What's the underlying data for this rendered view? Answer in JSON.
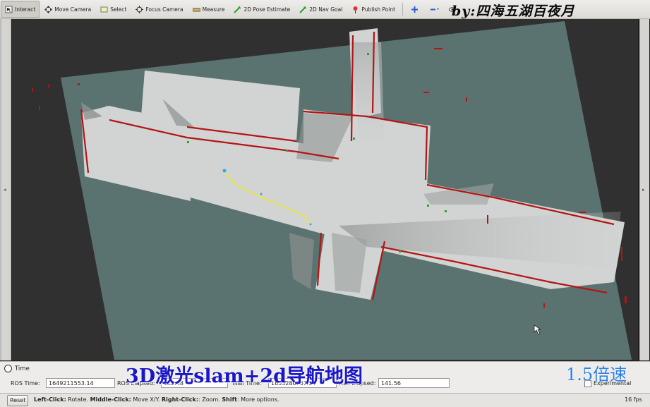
{
  "toolbar": {
    "tools": [
      {
        "label": "Interact",
        "icon": "interact-icon",
        "active": true
      },
      {
        "label": "Move Camera",
        "icon": "move-camera-icon"
      },
      {
        "label": "Select",
        "icon": "select-icon"
      },
      {
        "label": "Focus Camera",
        "icon": "focus-camera-icon"
      },
      {
        "label": "Measure",
        "icon": "measure-icon"
      },
      {
        "label": "2D Pose Estimate",
        "icon": "pose-estimate-icon"
      },
      {
        "label": "2D Nav Goal",
        "icon": "nav-goal-icon"
      },
      {
        "label": "Publish Point",
        "icon": "publish-point-icon"
      }
    ],
    "extra_icons": [
      "add-tool-icon",
      "remove-tool-icon",
      "view-eye-icon"
    ]
  },
  "watermark_top": "by:四海五湖百夜月",
  "colors": {
    "map_background": "#5a7370",
    "free_space": "#d6d8d7",
    "obstacle": "#b41515",
    "path": "#e8e44a",
    "title_overlay": "#1a17c9",
    "speed_overlay": "#2e7fe0"
  },
  "time_panel": {
    "title": "Time",
    "ros_time_label": "ROS Time:",
    "ros_time_value": "1649211553.14",
    "ros_elapsed_label": "ROS Elapsed:",
    "ros_elapsed_value": "122.48",
    "wall_time_label": "Wall Time:",
    "wall_time_value": "1653286767.54",
    "wall_elapsed_label": "Wall Elapsed:",
    "wall_elapsed_value": "141.56",
    "experimental_label": "Experimental"
  },
  "overlay_title": "3D激光slam+2d导航地图",
  "overlay_speed": "1.5倍速",
  "status_bar": {
    "reset_label": "Reset",
    "hint_left_click": "Left-Click:",
    "hint_left_action": " Rotate. ",
    "hint_middle_click": "Middle-Click:",
    "hint_middle_action": " Move X/Y. ",
    "hint_right_click": "Right-Click:",
    "hint_right_action": ": Zoom. ",
    "hint_shift": "Shift",
    "hint_shift_action": ": More options.",
    "fps": "16 fps"
  }
}
